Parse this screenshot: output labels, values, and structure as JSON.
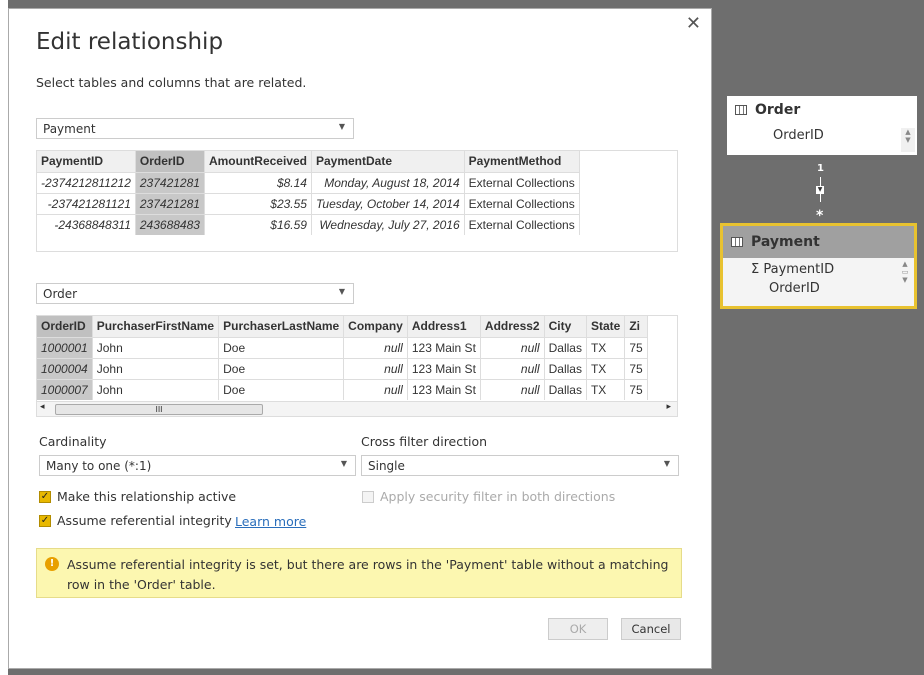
{
  "dialog": {
    "title": "Edit relationship",
    "subtitle": "Select tables and columns that are related.",
    "table1": {
      "selected": "Payment",
      "columns": [
        "PaymentID",
        "OrderID",
        "AmountReceived",
        "PaymentDate",
        "PaymentMethod"
      ],
      "rows": [
        [
          "-2374212811212",
          "237421281",
          "$8.14",
          "Monday, August 18, 2014",
          "External Collections"
        ],
        [
          "-237421281121",
          "237421281",
          "$23.55",
          "Tuesday, October 14, 2014",
          "External Collections"
        ],
        [
          "-24368848311",
          "243688483",
          "$16.59",
          "Wednesday, July 27, 2016",
          "External Collections"
        ]
      ]
    },
    "table2": {
      "selected": "Order",
      "columns": [
        "OrderID",
        "PurchaserFirstName",
        "PurchaserLastName",
        "Company",
        "Address1",
        "Address2",
        "City",
        "State",
        "Zi"
      ],
      "rows": [
        [
          "1000001",
          "John",
          "Doe",
          "null",
          "123 Main St",
          "null",
          "Dallas",
          "TX",
          "75"
        ],
        [
          "1000004",
          "John",
          "Doe",
          "null",
          "123 Main St",
          "null",
          "Dallas",
          "TX",
          "75"
        ],
        [
          "1000007",
          "John",
          "Doe",
          "null",
          "123 Main St",
          "null",
          "Dallas",
          "TX",
          "75"
        ]
      ]
    },
    "cardinality_label": "Cardinality",
    "cardinality_value": "Many to one (*:1)",
    "crossfilter_label": "Cross filter direction",
    "crossfilter_value": "Single",
    "active_label": "Make this relationship active",
    "integrity_label": "Assume referential integrity",
    "learn_more": "Learn more",
    "security_label": "Apply security filter in both directions",
    "warning": "Assume referential integrity is set, but there are rows in the 'Payment' table without a matching row in the 'Order' table.",
    "ok": "OK",
    "cancel": "Cancel"
  },
  "diagram": {
    "order": {
      "title": "Order",
      "fields": [
        "OrderID"
      ]
    },
    "payment": {
      "title": "Payment",
      "fields": [
        "PaymentID",
        "OrderID"
      ]
    },
    "one": "1",
    "many": "*",
    "accent": "#e8c230"
  }
}
